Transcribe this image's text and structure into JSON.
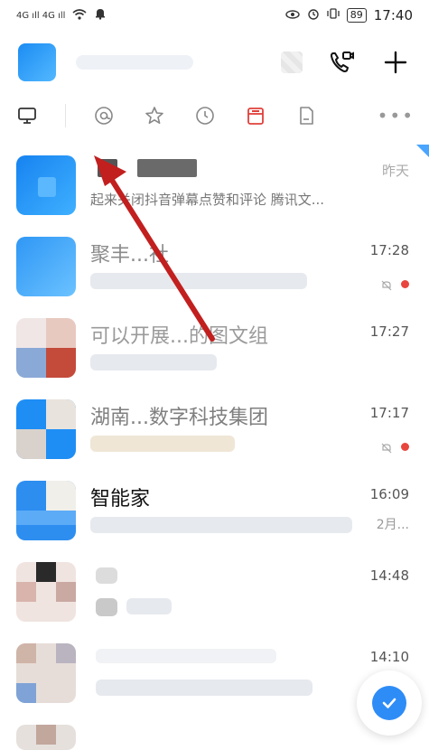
{
  "status_bar": {
    "signal_left": "4G ıll 4G ıll",
    "battery": "89",
    "time": "17:40"
  },
  "tabs": [
    "monitor-icon",
    "at-icon",
    "star-icon",
    "history-icon",
    "calendar-icon",
    "document-icon"
  ],
  "conversations": [
    {
      "title": "",
      "subtitle": "起来关闭抖音弹幕点赞和评论 腾讯文...",
      "time": "昨天"
    },
    {
      "title": "聚丰...社",
      "subtitle": "",
      "time": "17:28"
    },
    {
      "title": "可以开展...的图文组",
      "subtitle": "",
      "time": "17:27"
    },
    {
      "title": "湖南...数字科技集团",
      "subtitle": "",
      "time": "17:17"
    },
    {
      "title": "智能家",
      "subtitle": "",
      "time": "16:09",
      "right_sub": "2月..."
    },
    {
      "title": "",
      "subtitle": "",
      "time": "14:48"
    },
    {
      "title": "",
      "subtitle": "",
      "time": "14:10"
    }
  ]
}
